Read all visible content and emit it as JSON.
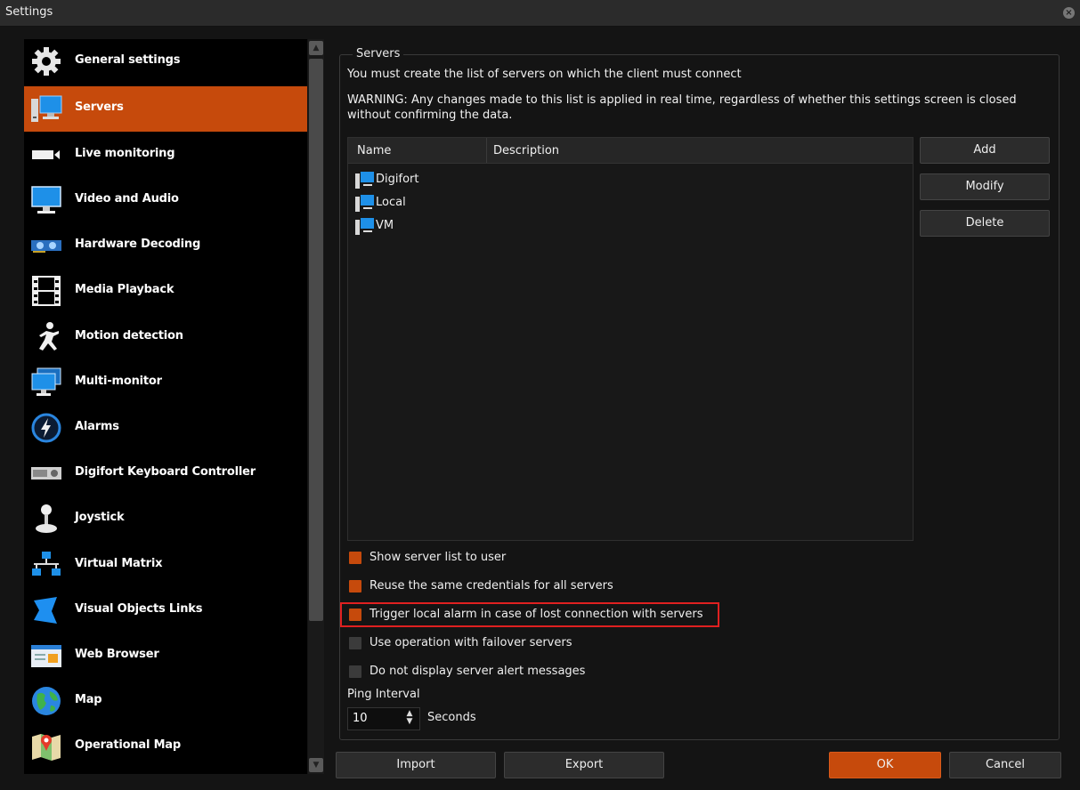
{
  "window": {
    "title": "Settings"
  },
  "sidebar": {
    "active_index": 1,
    "items": [
      {
        "label": "General settings",
        "icon": "gear-icon"
      },
      {
        "label": "Servers",
        "icon": "server-icon"
      },
      {
        "label": "Live monitoring",
        "icon": "camera-icon"
      },
      {
        "label": "Video and Audio",
        "icon": "monitor-icon"
      },
      {
        "label": "Hardware Decoding",
        "icon": "gpu-card-icon"
      },
      {
        "label": "Media Playback",
        "icon": "film-icon"
      },
      {
        "label": "Motion detection",
        "icon": "running-man-icon"
      },
      {
        "label": "Multi-monitor",
        "icon": "multi-monitor-icon"
      },
      {
        "label": "Alarms",
        "icon": "lightning-icon"
      },
      {
        "label": "Digifort Keyboard Controller",
        "icon": "keyboard-controller-icon"
      },
      {
        "label": "Joystick",
        "icon": "joystick-icon"
      },
      {
        "label": "Virtual Matrix",
        "icon": "network-icon"
      },
      {
        "label": "Visual Objects Links",
        "icon": "shield-icon"
      },
      {
        "label": "Web Browser",
        "icon": "browser-window-icon"
      },
      {
        "label": "Map",
        "icon": "globe-icon"
      },
      {
        "label": "Operational Map",
        "icon": "map-pin-icon"
      }
    ]
  },
  "servers": {
    "group_title": "Servers",
    "info_line1": "You must create the list of servers on which the client must connect",
    "warning_line1": "WARNING: Any changes made to this list is applied in real time, regardless of whether this settings screen is closed",
    "warning_line2": "without confirming the data.",
    "columns": {
      "name": "Name",
      "description": "Description"
    },
    "rows": [
      {
        "name": "Digifort",
        "description": ""
      },
      {
        "name": "Local",
        "description": ""
      },
      {
        "name": "VM",
        "description": ""
      }
    ],
    "buttons": {
      "add": "Add",
      "modify": "Modify",
      "delete": "Delete"
    },
    "options": [
      {
        "label": "Show server list to user",
        "checked": true
      },
      {
        "label": "Reuse the same credentials for all servers",
        "checked": true
      },
      {
        "label": "Trigger local alarm in case of lost connection with servers",
        "checked": true
      },
      {
        "label": "Use operation with failover servers",
        "checked": false
      },
      {
        "label": "Do not display server alert messages",
        "checked": false
      }
    ],
    "ping_interval": {
      "label": "Ping Interval",
      "value": "10",
      "unit": "Seconds"
    }
  },
  "footer": {
    "import": "Import",
    "export": "Export",
    "ok": "OK",
    "cancel": "Cancel"
  },
  "colors": {
    "accent": "#c64a0c",
    "highlight_border": "#e02020"
  }
}
